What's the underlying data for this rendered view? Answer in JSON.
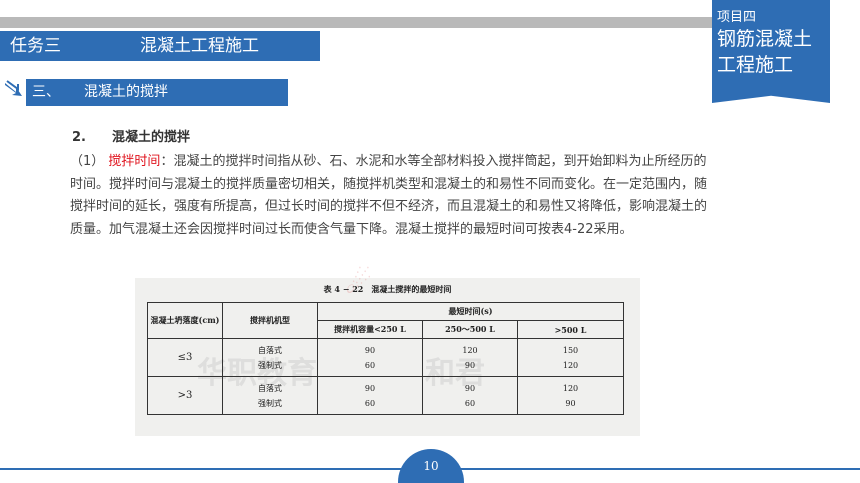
{
  "header": {
    "task_label": "任务三",
    "task_title": "混凝土工程施工",
    "project_label": "项目四",
    "project_title": "钢筋混凝土工程施工"
  },
  "section": {
    "number": "三、",
    "title": "混凝土的搅拌"
  },
  "content": {
    "heading_number": "2.",
    "heading_text": "混凝土的搅拌",
    "para_prefix": "（1）",
    "term": "搅拌时间",
    "body": "：混凝土的搅拌时间指从砂、石、水泥和水等全部材料投入搅拌筒起，到开始卸料为止所经历的时间。搅拌时间与混凝土的搅拌质量密切相关，随搅拌机类型和混凝土的和易性不同而变化。在一定范围内，随搅拌时间的延长，强度有所提高，但过长时间的搅拌不但不经济，而且混凝土的和易性又将降低，影响混凝土的质量。加气混凝土还会因搅拌时间过长而使含气量下降。混凝土搅拌的最短时间可按表4-22采用。"
  },
  "table": {
    "title": "表 4 − 22　混凝土搅拌的最短时间",
    "col_slump": "混凝土坍落度(cm)",
    "col_mixer_type": "搅拌机机型",
    "col_min_time": "最短时间(s)",
    "sub_headers": [
      "搅拌机容量<250 L",
      "250～500 L",
      ">500 L"
    ],
    "rows": [
      {
        "slump": "≤3",
        "types": [
          "自落式",
          "强制式"
        ],
        "c1": [
          "90",
          "60"
        ],
        "c2": [
          "120",
          "90"
        ],
        "c3": [
          "150",
          "120"
        ]
      },
      {
        "slump": ">3",
        "types": [
          "自落式",
          "强制式"
        ],
        "c1": [
          "90",
          "60"
        ],
        "c2": [
          "90",
          "60"
        ],
        "c3": [
          "120",
          "90"
        ]
      }
    ],
    "watermarks": [
      "华职教育",
      "和君"
    ]
  },
  "footer": {
    "page_number": "10"
  },
  "colors": {
    "accent": "#2e6db4",
    "highlight": "#e0141e",
    "bar_gray": "#b9b9b9"
  },
  "icons": {
    "section_marker": "arrow-down-right-icon"
  }
}
